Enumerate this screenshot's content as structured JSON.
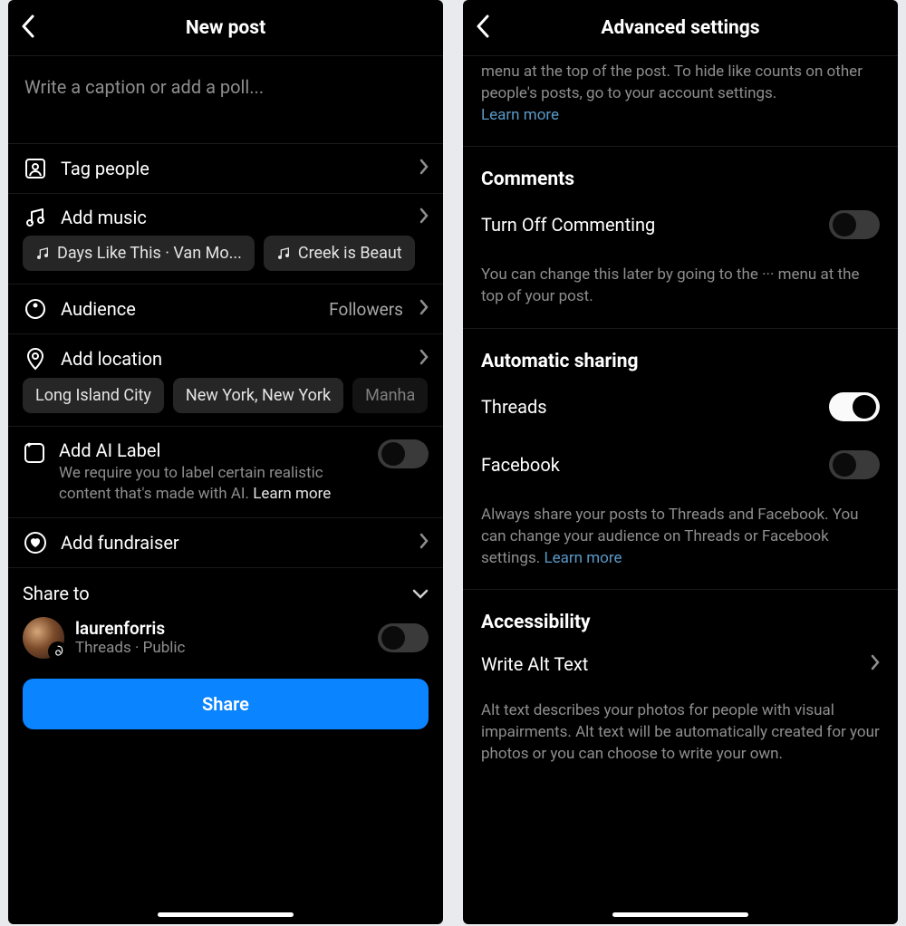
{
  "left": {
    "header": {
      "title": "New post"
    },
    "caption_placeholder": "Write a caption or add a poll...",
    "tag_people": "Tag people",
    "add_music": "Add music",
    "music_chips": [
      "Days Like This · Van Mo...",
      "Creek is Beaut"
    ],
    "audience": {
      "label": "Audience",
      "value": "Followers"
    },
    "add_location": "Add location",
    "location_chips": [
      "Long Island City",
      "New York, New York",
      "Manha"
    ],
    "ai": {
      "title": "Add AI Label",
      "desc": "We require you to label certain realistic content that's made with AI. ",
      "learn": "Learn more"
    },
    "add_fundraiser": "Add fundraiser",
    "share_to": "Share to",
    "account": {
      "name": "laurenforris",
      "sub": "Threads · Public"
    },
    "share_btn": "Share"
  },
  "right": {
    "header": {
      "title": "Advanced settings"
    },
    "top_desc": "menu at the top of the post. To hide like counts on other people's posts, go to your account settings.",
    "top_learn": "Learn more",
    "comments": {
      "title": "Comments",
      "toggle_label": "Turn Off Commenting",
      "desc": "You can change this later by going to the ··· menu at the top of your post."
    },
    "sharing": {
      "title": "Automatic sharing",
      "threads": "Threads",
      "facebook": "Facebook",
      "desc": "Always share your posts to Threads and Facebook. You can change your audience on Threads or Facebook settings. ",
      "learn": "Learn more"
    },
    "accessibility": {
      "title": "Accessibility",
      "alt": "Write Alt Text",
      "desc": "Alt text describes your photos for people with visual impairments. Alt text will be automatically created for your photos or you can choose to write your own."
    }
  }
}
